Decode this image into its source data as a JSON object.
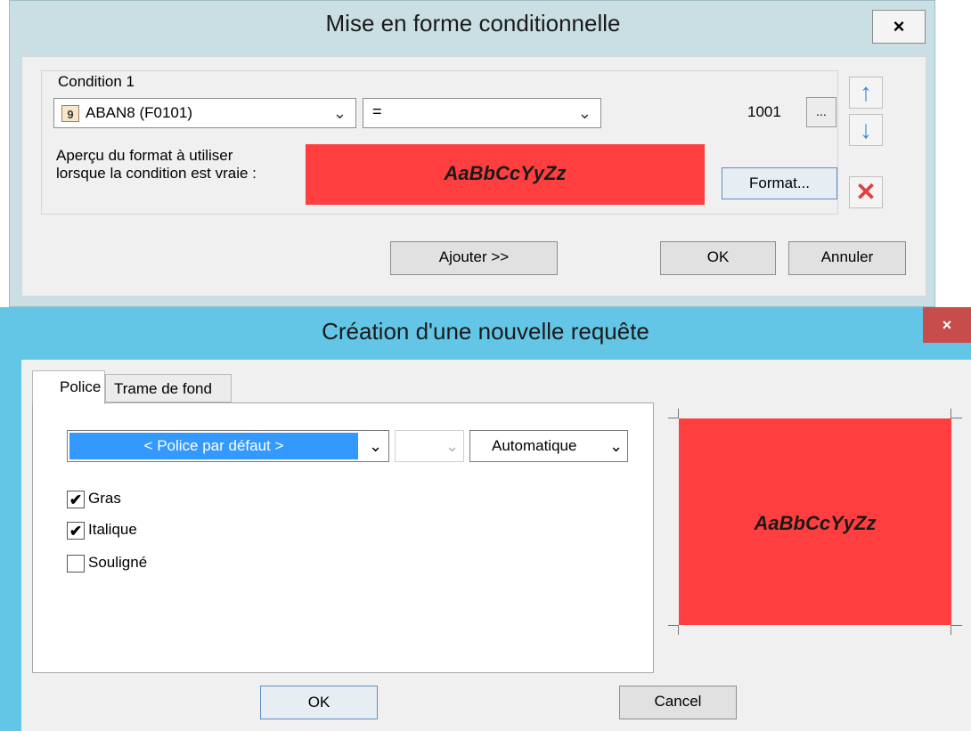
{
  "window1": {
    "title": "Mise en forme conditionnelle",
    "close_label": "×",
    "condition_label": "Condition 1",
    "field_icon_text": "9",
    "field_value": "ABAN8 (F0101)",
    "operator_value": "=",
    "condition_value": "1001",
    "ellipsis_label": "...",
    "preview_label_line1": "Aperçu du format à utiliser",
    "preview_label_line2": "lorsque la condition est vraie :",
    "preview_sample": "AaBbCcYyZz",
    "preview_color": "#ff3f3f",
    "format_button": "Format...",
    "up_icon": "arrow-up-icon",
    "down_icon": "arrow-down-icon",
    "delete_icon": "delete-icon",
    "add_button": "Ajouter >>",
    "ok_button": "OK",
    "cancel_button": "Annuler"
  },
  "window2": {
    "title": "Création d'une nouvelle requête",
    "close_label": "×",
    "tabs": [
      {
        "label": "Police",
        "active": true
      },
      {
        "label": "Trame de fond",
        "active": false
      }
    ],
    "font_selected": "< Police par défaut >",
    "size_value": "",
    "color_value": "Automatique",
    "checkboxes": [
      {
        "label": "Gras",
        "checked": true
      },
      {
        "label": "Italique",
        "checked": true
      },
      {
        "label": "Souligné",
        "checked": false
      }
    ],
    "check_mark": "✔",
    "preview_sample": "AaBbCcYyZz",
    "preview_color": "#ff3f3f",
    "ok_button": "OK",
    "cancel_button": "Cancel"
  },
  "colors": {
    "window1_frame": "#c9dfe4",
    "window2_frame": "#64c6e6",
    "selection_blue": "#3399ff",
    "close_red": "#c74d4d",
    "arrow_blue": "#2e8fe0"
  }
}
